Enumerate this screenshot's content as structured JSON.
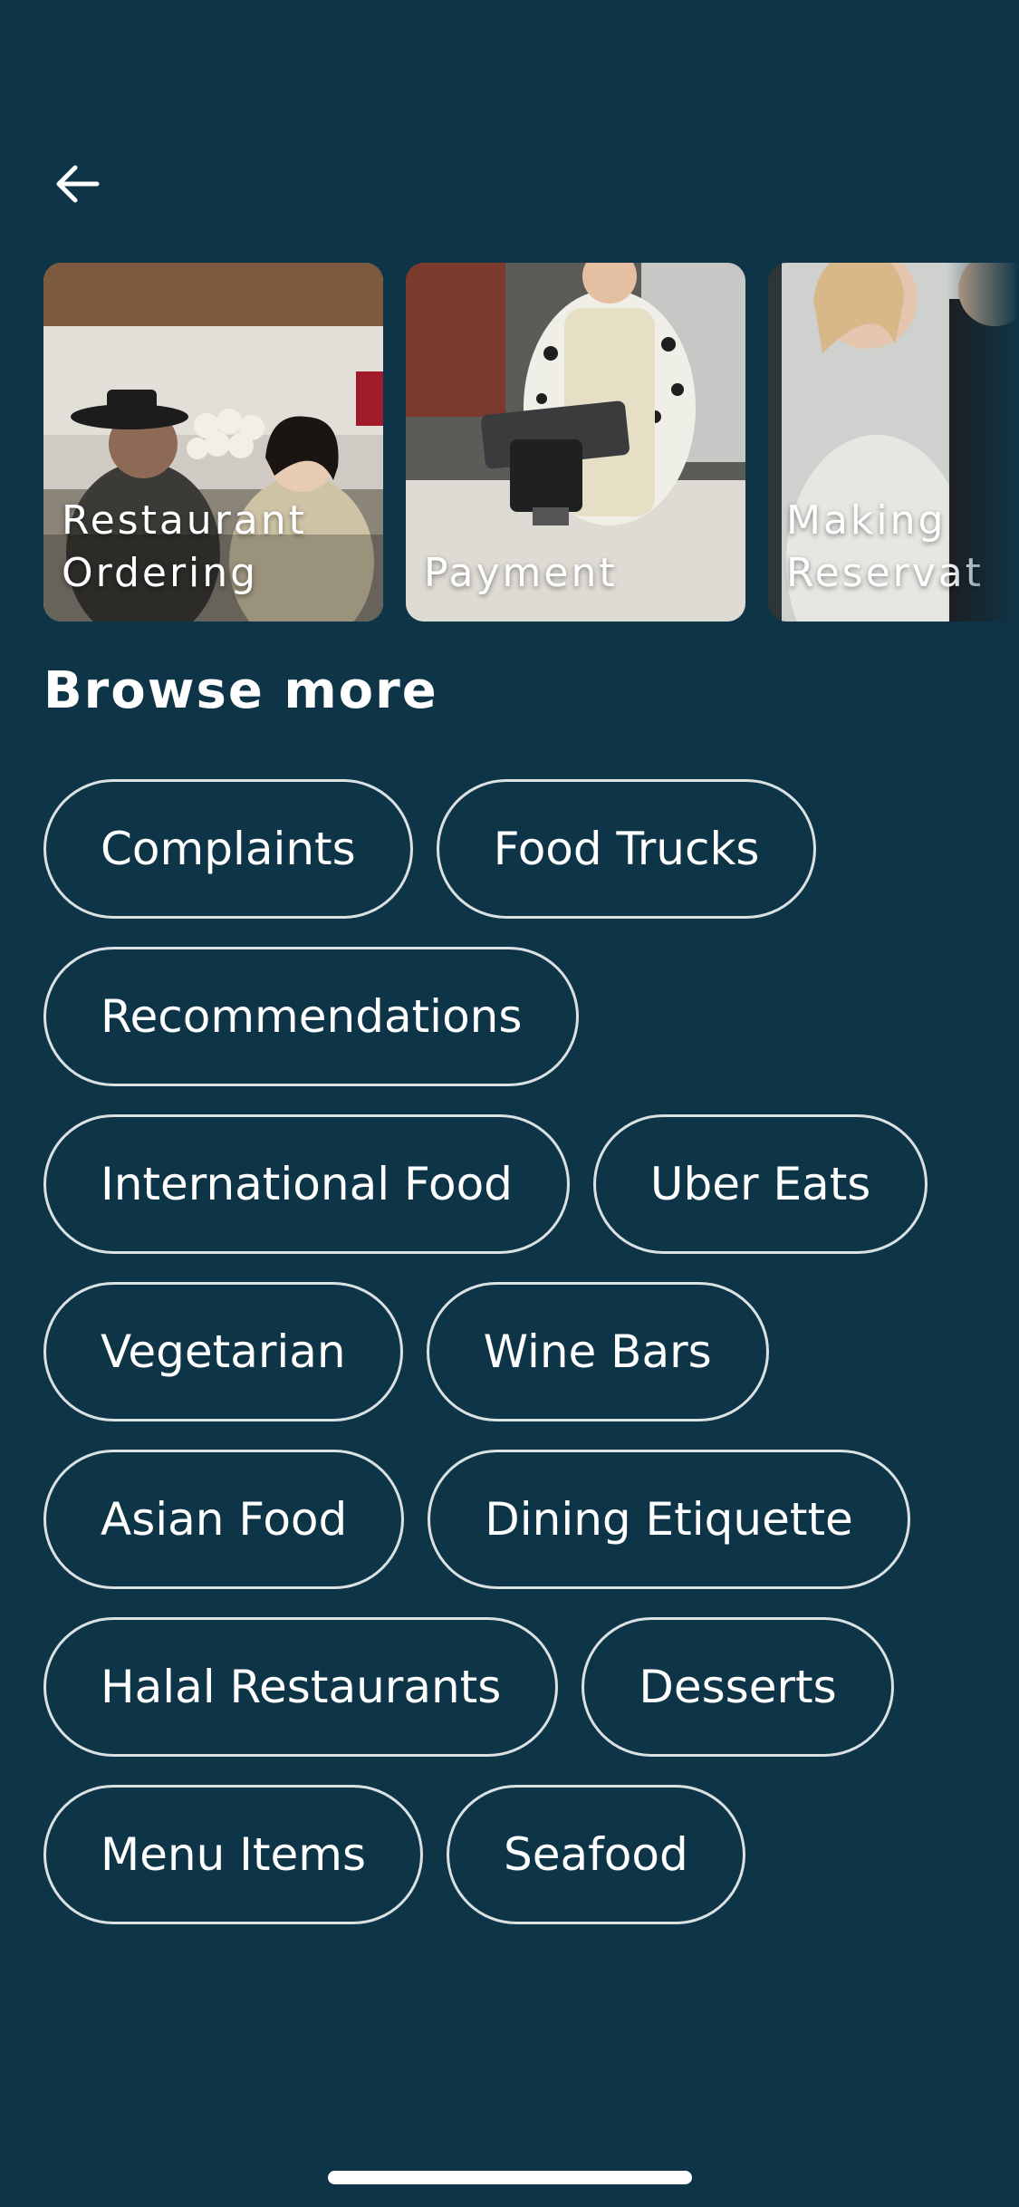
{
  "nav": {
    "back_icon": "arrow-left-icon"
  },
  "carousel": {
    "cards": [
      {
        "label": "Restaurant\nOrdering",
        "image": "couple-restaurant-photo"
      },
      {
        "label": "Payment",
        "image": "cashier-payment-photo"
      },
      {
        "label": "Making\nReservat",
        "image": "reservation-photo"
      }
    ]
  },
  "browse": {
    "title": "Browse more",
    "rows": [
      [
        "Complaints",
        "Food Trucks"
      ],
      [
        "Recommendations"
      ],
      [
        "International Food",
        "Uber Eats"
      ],
      [
        "Vegetarian",
        "Wine Bars"
      ],
      [
        "Asian Food",
        "Dining Etiquette"
      ],
      [
        "Halal Restaurants",
        "Desserts"
      ],
      [
        "Menu Items",
        "Seafood"
      ]
    ]
  },
  "colors": {
    "background": "#0e3547",
    "text": "#ffffff",
    "chip_border": "#ffffff"
  }
}
